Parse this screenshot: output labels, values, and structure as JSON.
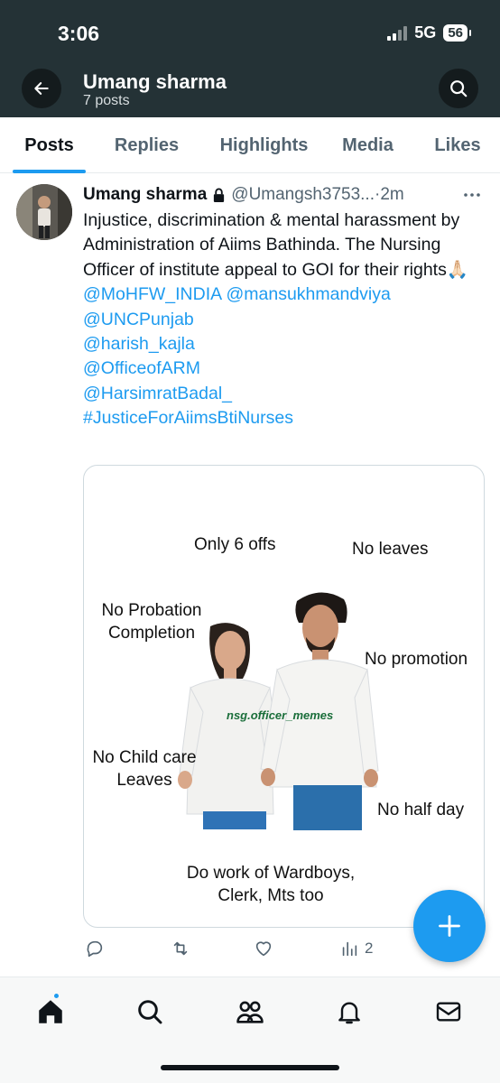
{
  "status_bar": {
    "time": "3:06",
    "network": "5G",
    "battery": "56"
  },
  "header": {
    "name": "Umang sharma",
    "posts": "7 posts"
  },
  "tabs": [
    {
      "label": "Posts",
      "active": true
    },
    {
      "label": "Replies",
      "active": false
    },
    {
      "label": "Highlights",
      "active": false
    },
    {
      "label": "Media",
      "active": false
    },
    {
      "label": "Likes",
      "active": false
    }
  ],
  "tweet": {
    "author": "Umang sharma",
    "handle": "@Umangsh3753...",
    "time": "·2m",
    "text": "Injustice, discrimination & mental harassment by Administration of Aiims Bathinda. The Nursing Officer of institute appeal to GOI for their rights🙏🏻",
    "mentions": [
      "@MoHFW_INDIA @mansukhmandviya",
      "@UNCPunjab",
      "@harish_kajla",
      "@OfficeofARM",
      "@HarsimratBadal_",
      "#JusticeForAiimsBtiNurses"
    ],
    "image": {
      "only_6_offs": "Only 6 offs",
      "no_leaves": "No leaves",
      "no_probation_line1": "No Probation",
      "no_probation_line2": "Completion",
      "no_promotion": "No promotion",
      "watermark": "nsg.officer_memes",
      "no_child_care_line1": "No Child care",
      "no_child_care_line2": "Leaves",
      "no_half_day": "No half day",
      "do_work_line1": "Do work of Wardboys,",
      "do_work_line2": "Clerk, Mts too"
    },
    "views": "2"
  },
  "colors": {
    "header_bg": "#243236",
    "accent": "#1d9bf0",
    "text_primary": "#0f1419",
    "text_secondary": "#536471"
  },
  "icons": {
    "back": "arrow-left-icon",
    "search": "search-icon",
    "lock": "lock-icon",
    "more": "more-icon",
    "reply": "reply-icon",
    "repost": "repost-icon",
    "like": "heart-icon",
    "views": "views-icon",
    "compose": "plus-icon",
    "nav": [
      "home-icon",
      "search-icon",
      "communities-icon",
      "bell-icon",
      "mail-icon"
    ]
  }
}
